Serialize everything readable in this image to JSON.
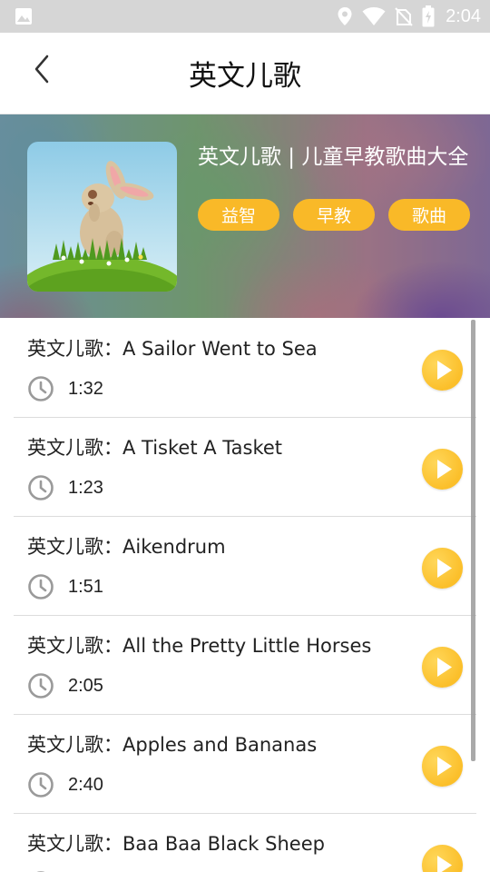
{
  "status_bar": {
    "time": "2:04",
    "icons": [
      "gallery-icon",
      "location-icon",
      "wifi-icon",
      "no-sim-icon",
      "battery-charging-icon"
    ]
  },
  "header": {
    "title": "英文儿歌",
    "back_icon": "chevron-left-icon"
  },
  "banner": {
    "title": "英文儿歌 | 儿童早教歌曲大全",
    "tags": [
      "益智",
      "早教",
      "歌曲"
    ]
  },
  "songs": [
    {
      "title": "英文儿歌：A Sailor Went to Sea",
      "duration": "1:32"
    },
    {
      "title": "英文儿歌：A Tisket A Tasket",
      "duration": "1:23"
    },
    {
      "title": "英文儿歌：Aikendrum",
      "duration": "1:51"
    },
    {
      "title": "英文儿歌：All the Pretty Little Horses",
      "duration": "2:05"
    },
    {
      "title": "英文儿歌：Apples and Bananas",
      "duration": "2:40"
    },
    {
      "title": "英文儿歌：Baa Baa Black Sheep",
      "duration": ""
    }
  ],
  "colors": {
    "accent": "#f9b928",
    "play": "#fbbf2a",
    "status_bar": "#d6d6d6"
  }
}
